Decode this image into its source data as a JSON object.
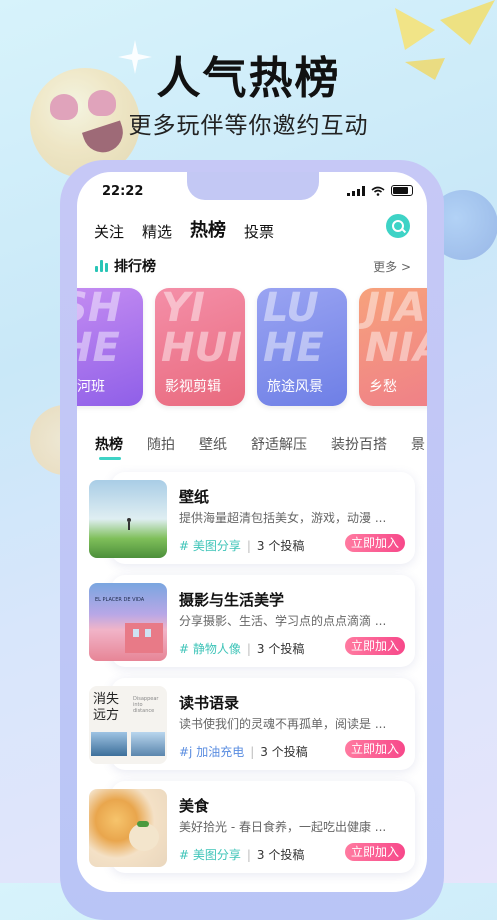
{
  "hero": {
    "title": "人气热榜",
    "subtitle": "更多玩伴等你邀约互动"
  },
  "status_bar": {
    "time": "22:22"
  },
  "top_tabs": [
    {
      "label": "关注"
    },
    {
      "label": "精选"
    },
    {
      "label": "热榜",
      "active": true
    },
    {
      "label": "投票"
    }
  ],
  "ranking": {
    "title": "排行榜",
    "more": "更多 >"
  },
  "rank_cards": [
    {
      "label": "山河班",
      "bg_text": "SH HE",
      "colors": [
        "#c68ef2",
        "#8f5fe8"
      ]
    },
    {
      "label": "影视剪辑",
      "bg_text": "YI HUI",
      "colors": [
        "#f48fa8",
        "#e96a7e"
      ]
    },
    {
      "label": "旅途风景",
      "bg_text": "LU HE",
      "colors": [
        "#9aa4f2",
        "#6e7fe6"
      ]
    },
    {
      "label": "乡愁",
      "bg_text": "JIA NIA",
      "colors": [
        "#f7a27c",
        "#ef7f88"
      ]
    }
  ],
  "category_tabs": [
    {
      "label": "热榜",
      "active": true
    },
    {
      "label": "随拍"
    },
    {
      "label": "壁纸"
    },
    {
      "label": "舒适解压"
    },
    {
      "label": "装扮百搭"
    },
    {
      "label": "景"
    }
  ],
  "groups": [
    {
      "title": "壁纸",
      "desc": "提供海量超清包括美女，游戏，动漫 ...",
      "tag": "# 美图分享",
      "count": "3 个投稿",
      "join": "立即加入"
    },
    {
      "title": "摄影与生活美学",
      "desc": "分享摄影、生活、学习点的点点滴滴 ...",
      "tag": "# 静物人像",
      "count": "3 个投稿",
      "join": "立即加入"
    },
    {
      "title": "读书语录",
      "desc": "读书使我们的灵魂不再孤单，阅读是 ...",
      "tag": "#j 加油充电",
      "count": "3 个投稿",
      "join": "立即加入"
    },
    {
      "title": "美食",
      "desc": "美好拾光 - 春日食养，一起吃出健康 ...",
      "tag": "# 美图分享",
      "count": "3 个投稿",
      "join": "立即加入"
    }
  ],
  "thumb_texts": {
    "photo_caption": "EL PLACER DE VIDA",
    "book_big": "消失 远方",
    "book_small": "Disappear into distance"
  }
}
